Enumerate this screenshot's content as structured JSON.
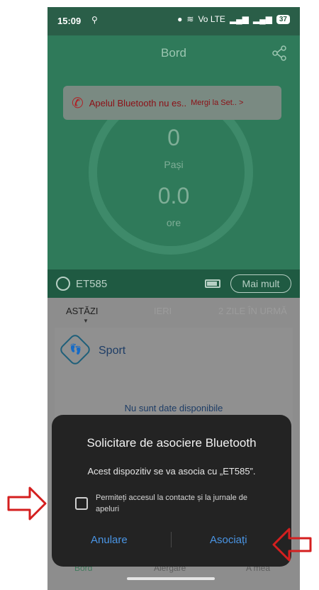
{
  "status_bar": {
    "time": "15:09",
    "network_label": "Vo LTE",
    "battery_level": "37"
  },
  "header": {
    "title": "Bord"
  },
  "toast": {
    "message": "Apelul Bluetooth nu es..",
    "link": "Mergi la Set.. >"
  },
  "dashboard": {
    "steps_value": "0",
    "steps_label": "Pași",
    "hours_value": "0.0",
    "hours_label": "ore"
  },
  "device": {
    "name": "ET585",
    "more_label": "Mai mult"
  },
  "day_tabs": {
    "today": "ASTĂZI",
    "yesterday": "IERI",
    "two_days_ago": "2 ZILE ÎN URMĂ"
  },
  "sport": {
    "title": "Sport",
    "no_data": "Nu sunt date disponibile"
  },
  "bottom_nav": {
    "items": [
      "Bord",
      "Alergare",
      "A mea"
    ]
  },
  "dialog": {
    "title": "Solicitare de asociere Bluetooth",
    "message": "Acest dispozitiv se va asocia cu „ET585”.",
    "checkbox_label": "Permiteți accesul la contacte și la jurnale de apeluri",
    "checkbox_checked": false,
    "cancel_label": "Anulare",
    "confirm_label": "Asociați"
  },
  "colors": {
    "accent": "#4a95e5",
    "header_green": "#2f7a5a",
    "annotation_red": "#d41f1f"
  }
}
